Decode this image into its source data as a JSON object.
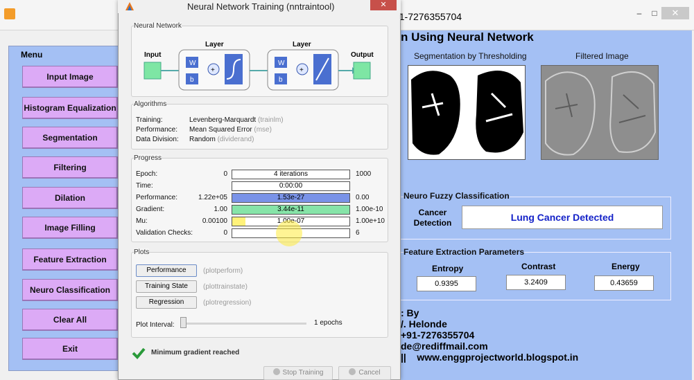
{
  "app": {
    "title": ": +91-7276355704",
    "heading": "n Using Neural Network",
    "window_controls": {
      "minimize": "–",
      "maximize": "□",
      "close": "✕"
    },
    "menu": {
      "title": "Menu",
      "items": [
        "Input Image",
        "Histogram Equalization",
        "Segmentation",
        "Filtering",
        "Dilation",
        "Image Filling",
        "Feature Extraction",
        "Neuro Classification",
        "Clear All",
        "Exit"
      ]
    },
    "images": {
      "left_label": "Segmentation by Thresholding",
      "right_label": "Filtered Image"
    },
    "neuro": {
      "title": "Neuro Fuzzy Classification",
      "label": "Cancer\nDetection",
      "result": "Lung Cancer Detected"
    },
    "features": {
      "title": "Feature Extraction Parameters",
      "items": [
        {
          "label": "Entropy",
          "value": "0.9395"
        },
        {
          "label": "Contrast",
          "value": "3.2409"
        },
        {
          "label": "Energy",
          "value": "0.43659"
        }
      ]
    },
    "contact": {
      "line1": ": By",
      "line2": "/. Helonde",
      "line3": "+91-7276355704",
      "line4": "de@rediffmail.com",
      "line5": "||    www.enggprojectworld.blogspot.in"
    }
  },
  "nntraintool": {
    "title": "Neural Network Training (nntraintool)",
    "close": "✕",
    "network": {
      "title": "Neural Network",
      "input": "Input",
      "layer1": "Layer",
      "layer2": "Layer",
      "output": "Output",
      "w": "W",
      "b": "b"
    },
    "algorithms": {
      "title": "Algorithms",
      "rows": [
        {
          "label": "Training:",
          "value": "Levenberg-Marquardt",
          "hint": "(trainlm)"
        },
        {
          "label": "Performance:",
          "value": "Mean Squared Error",
          "hint": "(mse)"
        },
        {
          "label": "Data Division:",
          "value": "Random",
          "hint": "(dividerand)"
        }
      ]
    },
    "progress": {
      "title": "Progress",
      "rows": [
        {
          "label": "Epoch:",
          "start": "0",
          "value": "4 iterations",
          "end": "1000",
          "color": "#ffffff",
          "fill": 0
        },
        {
          "label": "Time:",
          "start": "",
          "value": "0:00:00",
          "end": "",
          "color": "#ffffff",
          "fill": 0
        },
        {
          "label": "Performance:",
          "start": "1.22e+05",
          "value": "1.53e-27",
          "end": "0.00",
          "color": "#7a93e8",
          "fill": 1
        },
        {
          "label": "Gradient:",
          "start": "1.00",
          "value": "3.44e-11",
          "end": "1.00e-10",
          "color": "#86e4a8",
          "fill": 1
        },
        {
          "label": "Mu:",
          "start": "0.00100",
          "value": "1.00e-07",
          "end": "1.00e+10",
          "color": "#fff27a",
          "fill": 0.11
        },
        {
          "label": "Validation Checks:",
          "start": "0",
          "value": "",
          "end": "6",
          "color": "#ffffff",
          "fill": 0
        }
      ]
    },
    "plots": {
      "title": "Plots",
      "buttons": [
        {
          "label": "Performance",
          "hint": "(plotperform)"
        },
        {
          "label": "Training State",
          "hint": "(plottrainstate)"
        },
        {
          "label": "Regression",
          "hint": "(plotregression)"
        }
      ],
      "interval_label": "Plot Interval:",
      "interval_value": "1 epochs"
    },
    "status": "Minimum gradient reached",
    "stop_label": "Stop Training",
    "cancel_label": "Cancel"
  }
}
